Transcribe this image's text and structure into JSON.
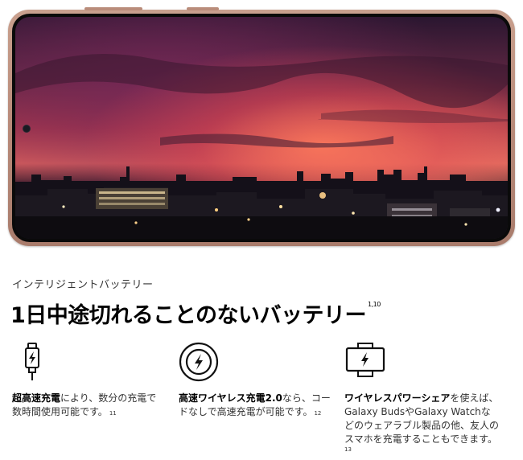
{
  "section": {
    "eyebrow": "インテリジェントバッテリー",
    "headline": "1日中途切れることのないバッテリー",
    "headline_note": "1,10"
  },
  "features": [
    {
      "icon": "charging-cable-icon",
      "bold": "超高速充電",
      "rest_line1": "により、数分の充電で",
      "line2": "数時間使用可能です。",
      "note": "11"
    },
    {
      "icon": "wireless-charging-icon",
      "bold": "高速ワイヤレス充電2.0",
      "rest_line1": "なら、コー",
      "line2": "ドなしで高速充電が可能です。",
      "note": "12"
    },
    {
      "icon": "wireless-powershare-icon",
      "bold": "ワイヤレスパワーシェア",
      "rest_line1": "を使えば、",
      "line2": "Galaxy BudsやGalaxy Watchな",
      "line3": "どのウェアラブル製品の他、友人の",
      "line4": "スマホを充電することもできます。",
      "note": "13"
    }
  ],
  "colors": {
    "phone_frame": "#b98c7a",
    "text_primary": "#000000",
    "text_secondary": "#333333"
  }
}
